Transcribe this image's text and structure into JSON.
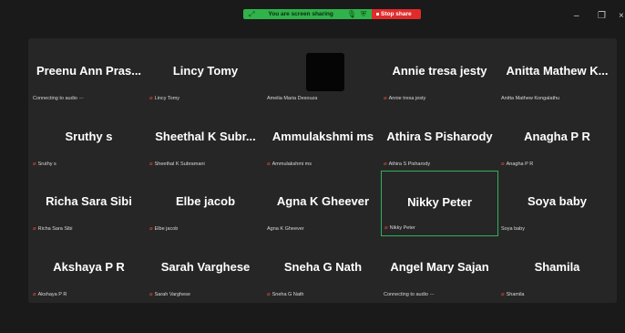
{
  "share_bar": {
    "sharing_text": "You are screen sharing",
    "stop_label": "Stop share"
  },
  "window_controls": {
    "minimize": "–",
    "maximize": "❐",
    "close": "×"
  },
  "participants": [
    {
      "name": "Preenu Ann Pras...",
      "label": "Connecting to audio ·-·",
      "muted": false
    },
    {
      "name": "Lincy Tomy",
      "label": "Lincy Tomy",
      "muted": true
    },
    {
      "name": "",
      "label": "Amelia Maria Desouza",
      "muted": false,
      "video": true
    },
    {
      "name": "Annie tresa jesty",
      "label": "Annie tresa jesty",
      "muted": true
    },
    {
      "name": "Anitta Mathew K...",
      "label": "Anitta Mathew Kongalathu",
      "muted": false
    },
    {
      "name": "Sruthy s",
      "label": "Sruthy s",
      "muted": true
    },
    {
      "name": "Sheethal K Subr...",
      "label": "Sheethal K Subramani",
      "muted": true
    },
    {
      "name": "Ammulakshmi ms",
      "label": "Ammulakshmi ms",
      "muted": true
    },
    {
      "name": "Athira S Pisharody",
      "label": "Athira S Pisharody",
      "muted": true
    },
    {
      "name": "Anagha P R",
      "label": "Anagha P R",
      "muted": true
    },
    {
      "name": "Richa Sara Sibi",
      "label": "Richa Sara Sibi",
      "muted": true
    },
    {
      "name": "Elbe jacob",
      "label": "Elbe jacob",
      "muted": true
    },
    {
      "name": "Agna K Gheever",
      "label": "Agna K Gheever",
      "muted": false
    },
    {
      "name": "Nikky Peter",
      "label": "Nikky Peter",
      "muted": true,
      "active": true
    },
    {
      "name": "Soya baby",
      "label": "Soya baby",
      "muted": false
    },
    {
      "name": "Akshaya P R",
      "label": "Akshaya P R",
      "muted": true
    },
    {
      "name": "Sarah Varghese",
      "label": "Sarah Varghese",
      "muted": true
    },
    {
      "name": "Sneha G Nath",
      "label": "Sneha G Nath",
      "muted": true
    },
    {
      "name": "Angel Mary Sajan",
      "label": "Connecting to audio ·-·",
      "muted": false
    },
    {
      "name": "Shamila",
      "label": "Shamila",
      "muted": true
    }
  ],
  "colors": {
    "active_border": "#2eb35a",
    "muted_icon": "#e74b3c",
    "share_green": "#2fb34a",
    "stop_red": "#e12b2b"
  }
}
